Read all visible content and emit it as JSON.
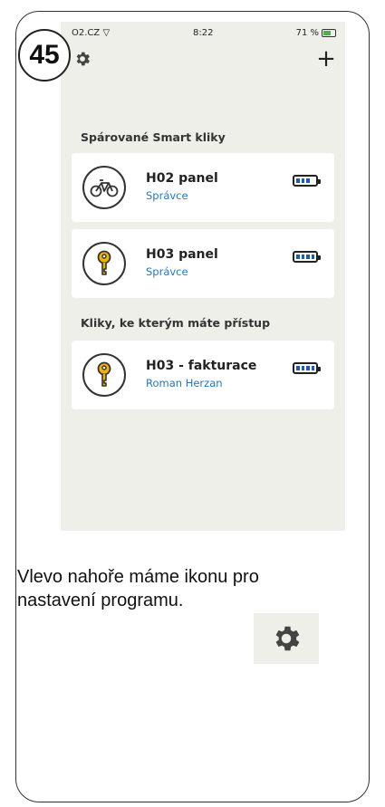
{
  "step": {
    "number": "45"
  },
  "status_bar": {
    "carrier": "O2.CZ",
    "time": "8:22",
    "battery": "71 %"
  },
  "toolbar": {
    "settings_icon": "gear-icon",
    "add_icon": "plus-icon",
    "add_label": "+"
  },
  "sections": {
    "paired": {
      "title": "Spárované Smart kliky",
      "items": [
        {
          "name": "H02 panel",
          "role": "Správce",
          "icon": "bicycle-icon",
          "battery_level": 0.75
        },
        {
          "name": "H03 panel",
          "role": "Správce",
          "icon": "key-icon",
          "battery_level": 1.0
        }
      ]
    },
    "access": {
      "title": "Kliky, ke kterým máte přístup",
      "items": [
        {
          "name": "H03 - fakturace",
          "role": "Roman Herzan",
          "icon": "key-icon",
          "battery_level": 1.0
        }
      ]
    }
  },
  "caption": {
    "line1": "Vlevo nahoře máme ikonu pro",
    "line2": "nastavení programu."
  },
  "colors": {
    "background": "#efefe9",
    "card": "#ffffff",
    "link_blue": "#1f78c8",
    "battery_fill": "#1a5bb8"
  }
}
